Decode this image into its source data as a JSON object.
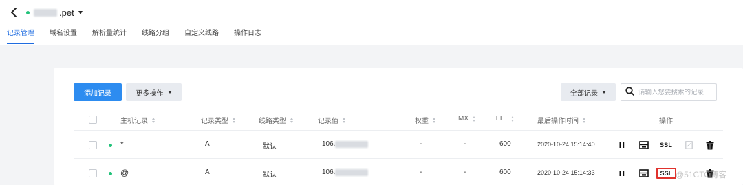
{
  "header": {
    "domain_suffix": ".pet",
    "status_color": "#22c27a"
  },
  "tabs": [
    {
      "label": "记录管理",
      "active": true
    },
    {
      "label": "域名设置",
      "active": false
    },
    {
      "label": "解析量统计",
      "active": false
    },
    {
      "label": "线路分组",
      "active": false
    },
    {
      "label": "自定义线路",
      "active": false
    },
    {
      "label": "操作日志",
      "active": false
    }
  ],
  "toolbar": {
    "add_label": "添加记录",
    "more_label": "更多操作",
    "all_label": "全部记录",
    "search_placeholder": "请输入您要搜索的记录"
  },
  "table": {
    "columns": {
      "host": "主机记录",
      "type": "记录类型",
      "line": "线路类型",
      "value": "记录值",
      "weight": "权重",
      "mx": "MX",
      "ttl": "TTL",
      "updated": "最后操作时间",
      "actions": "操作"
    },
    "rows": [
      {
        "host": "*",
        "type": "A",
        "line": "默认",
        "value": "106.",
        "weight": "-",
        "mx": "-",
        "ttl": "600",
        "updated": "2020-10-24 15:14:40",
        "ssl": "SSL"
      },
      {
        "host": "@",
        "type": "A",
        "line": "默认",
        "value": "106.",
        "weight": "-",
        "mx": "-",
        "ttl": "600",
        "updated": "2020-10-24 15:14:33",
        "ssl": "SSL"
      }
    ]
  },
  "icons": {
    "back": "chevron-left-icon",
    "pause": "pause-icon",
    "edit": "edit-icon",
    "remark": "remark-icon",
    "delete": "trash-icon",
    "search": "search-icon"
  },
  "watermark": "@51CTO博客",
  "accent_color": "#2d8cf0",
  "highlight_color": "#e0322d"
}
